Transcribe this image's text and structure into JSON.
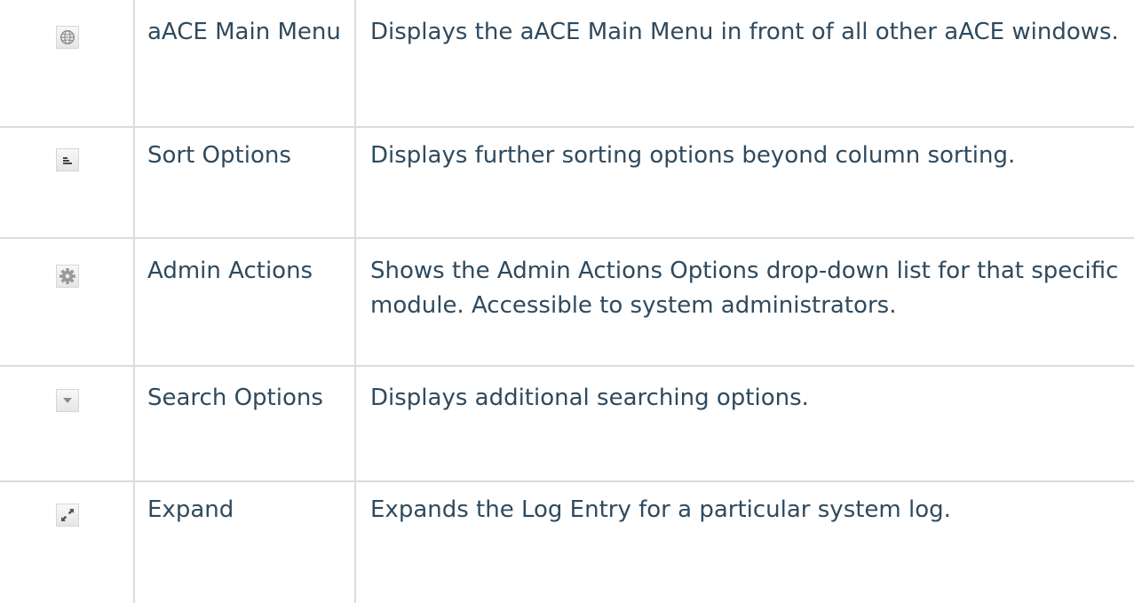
{
  "rows": [
    {
      "icon": "globe-icon",
      "name": "aACE Main Menu",
      "description": "Displays the aACE Main Menu in front of all other aACE windows."
    },
    {
      "icon": "sort-bars-icon",
      "name": "Sort Options",
      "description": "Displays further sorting options beyond column sorting."
    },
    {
      "icon": "gear-icon",
      "name": "Admin Actions",
      "description": "Shows the Admin Actions Options drop-down list for that specific module. Accessible to system administrators."
    },
    {
      "icon": "triangle-down-icon",
      "name": "Search Options",
      "description": "Displays additional searching options."
    },
    {
      "icon": "expand-arrows-icon",
      "name": "Expand",
      "description": "Expands the Log Entry for a particular system log."
    }
  ]
}
